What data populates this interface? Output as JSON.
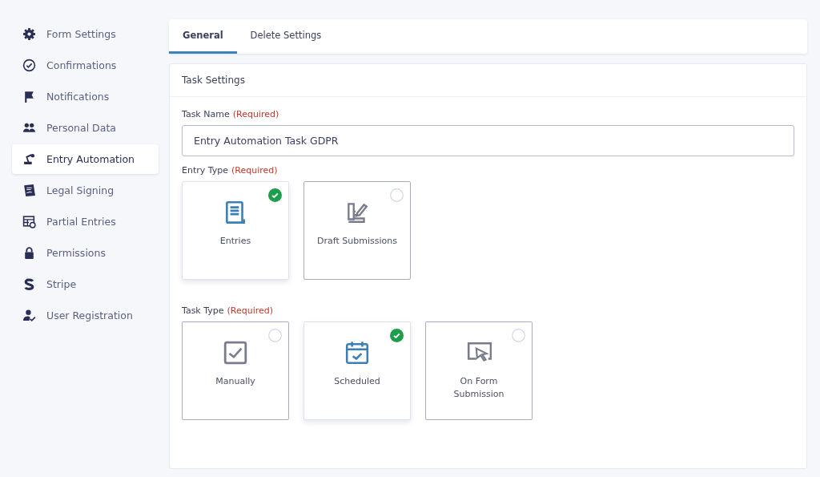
{
  "sidebar": {
    "items": [
      {
        "label": "Form Settings",
        "selected": false
      },
      {
        "label": "Confirmations",
        "selected": false
      },
      {
        "label": "Notifications",
        "selected": false
      },
      {
        "label": "Personal Data",
        "selected": false
      },
      {
        "label": "Entry Automation",
        "selected": true
      },
      {
        "label": "Legal Signing",
        "selected": false
      },
      {
        "label": "Partial Entries",
        "selected": false
      },
      {
        "label": "Permissions",
        "selected": false
      },
      {
        "label": "Stripe",
        "selected": false
      },
      {
        "label": "User Registration",
        "selected": false
      }
    ]
  },
  "tabs": [
    {
      "label": "General",
      "selected": true
    },
    {
      "label": "Delete Settings",
      "selected": false
    }
  ],
  "panel": {
    "title": "Task Settings",
    "task_name": {
      "label": "Task Name",
      "required": "(Required)",
      "value": "Entry Automation Task GDPR"
    },
    "entry_type": {
      "label": "Entry Type",
      "required": "(Required)",
      "options": [
        {
          "label": "Entries",
          "selected": true
        },
        {
          "label": "Draft Submissions",
          "selected": false
        }
      ]
    },
    "task_type": {
      "label": "Task Type",
      "required": "(Required)",
      "options": [
        {
          "label": "Manually",
          "selected": false
        },
        {
          "label": "Scheduled",
          "selected": true
        },
        {
          "label": "On Form Submission",
          "selected": false
        }
      ]
    }
  }
}
